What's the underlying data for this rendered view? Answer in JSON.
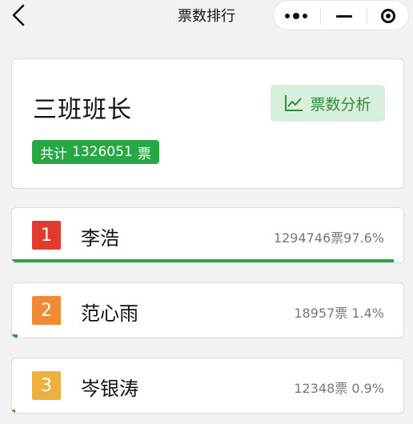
{
  "navbar": {
    "title": "票数排行",
    "back_icon": "chevron-left-icon",
    "menu_icon": "more-dots-icon",
    "minimize_icon": "minimize-icon",
    "close_icon": "target-close-icon"
  },
  "summary": {
    "group_name": "三班班长",
    "total_prefix": "共计",
    "total_votes": "1326051",
    "total_unit": "票",
    "analysis_label": "票数分析",
    "analysis_icon": "line-chart-icon"
  },
  "ranking": [
    {
      "rank": "1",
      "name": "李浩",
      "votes_text": "1294746票97.6%",
      "share": 0.976,
      "badge_color": "#e03b2e"
    },
    {
      "rank": "2",
      "name": "范心雨",
      "votes_text": "18957票  1.4%",
      "share": 0.014,
      "badge_color": "#ef8a35"
    },
    {
      "rank": "3",
      "name": "岑银涛",
      "votes_text": "12348票  0.9%",
      "share": 0.009,
      "badge_color": "#ecb13c"
    }
  ],
  "colors": {
    "accent_green": "#27a844"
  }
}
